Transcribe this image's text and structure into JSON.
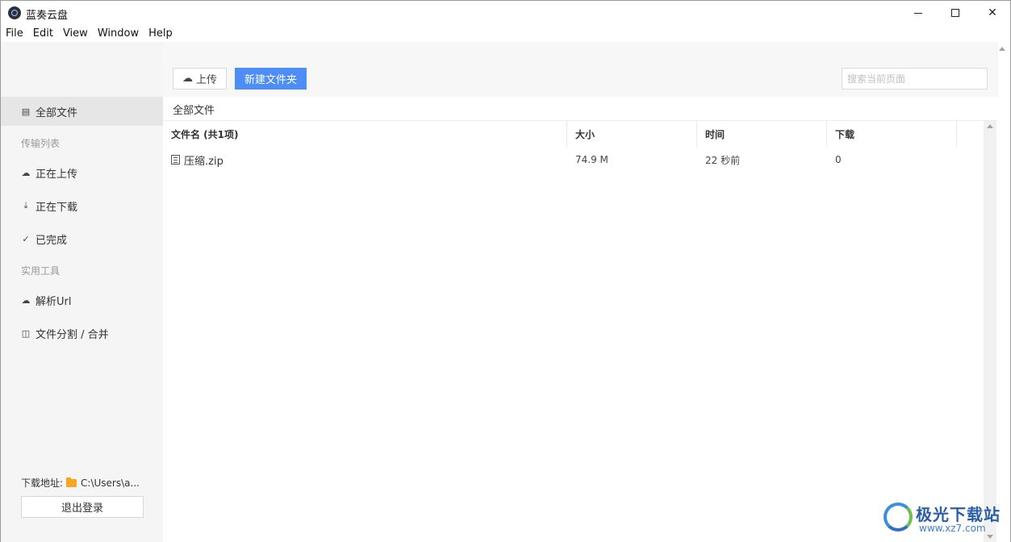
{
  "window": {
    "title": "蓝奏云盘",
    "minimize_glyph": "—",
    "maximize_glyph": "☐",
    "close_glyph": "✕"
  },
  "menu": [
    "File",
    "Edit",
    "View",
    "Window",
    "Help"
  ],
  "sidebar": {
    "all_files": "全部文件",
    "transfer_heading": "传输列表",
    "uploading": "正在上传",
    "downloading": "正在下载",
    "completed": "已完成",
    "tools_heading": "实用工具",
    "parse_url": "解析Url",
    "split_merge": "文件分割 / 合并",
    "download_path_label": "下载地址:",
    "download_path_value": "C:\\Users\\a...",
    "logout": "退出登录"
  },
  "toolbar": {
    "upload_label": "上传",
    "new_folder_label": "新建文件夹",
    "search_placeholder": "搜索当前页面",
    "accent_color": "#4c8df6"
  },
  "breadcrumb": "全部文件",
  "table": {
    "columns": [
      "文件名 (共1项)",
      "大小",
      "时间",
      "下载"
    ],
    "rows": [
      {
        "name": "压缩.zip",
        "size": "74.9 M",
        "time": "22 秒前",
        "downloads": "0"
      }
    ]
  },
  "watermark": {
    "text": "极光下载站",
    "url": "www.xz7.com"
  }
}
